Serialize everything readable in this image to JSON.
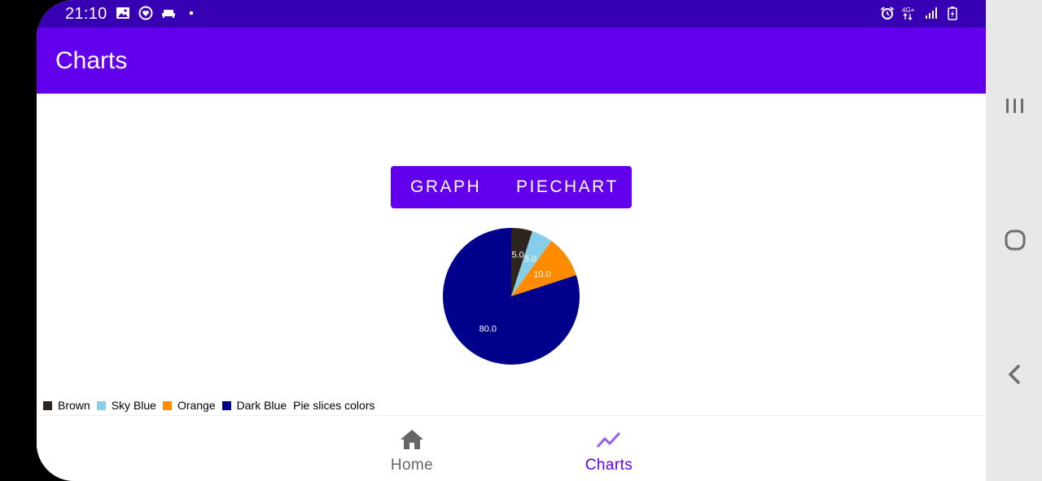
{
  "status_bar": {
    "time": "21:10",
    "left_icons": [
      "image-icon",
      "circle-heart-icon",
      "sofa-icon",
      "dot-icon"
    ],
    "right_icons": [
      "alarm-icon",
      "network-4g-icon",
      "signal-icon",
      "battery-icon"
    ],
    "network_label": "4G+"
  },
  "app_bar": {
    "title": "Charts"
  },
  "toggle": {
    "graph_label": "GRAPH",
    "piechart_label": "PIECHART"
  },
  "chart_data": {
    "type": "pie",
    "categories": [
      "Brown",
      "Sky Blue",
      "Orange",
      "Dark Blue"
    ],
    "values": [
      5.0,
      5.0,
      10.0,
      80.0
    ],
    "value_labels": [
      "5.0",
      "5.0",
      "10.0",
      "80.0"
    ],
    "colors": [
      "#2e241f",
      "#87ceeb",
      "#ff8c00",
      "#00008b"
    ],
    "legend_description": "Pie slices colors",
    "legend_position": "bottom-left"
  },
  "bottom_nav": {
    "items": [
      {
        "label": "Home",
        "icon": "home-icon",
        "active": false
      },
      {
        "label": "Charts",
        "icon": "trending-up-icon",
        "active": true
      }
    ]
  },
  "side_rail": {
    "buttons": [
      "recent-apps-icon",
      "home-circle-icon",
      "back-icon"
    ]
  },
  "colors": {
    "primary": "#6200ee",
    "primary_dark": "#3700b3",
    "inactive": "#666666"
  }
}
